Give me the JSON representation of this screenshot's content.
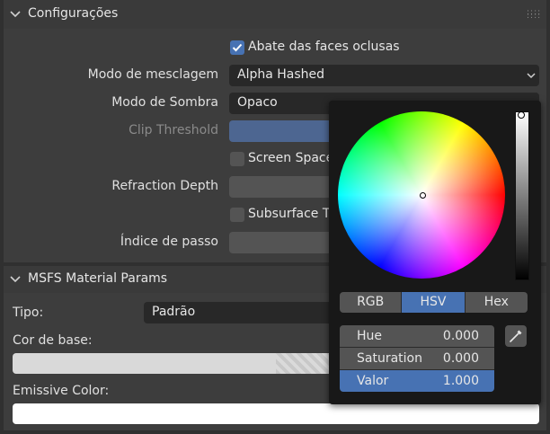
{
  "config_panel": {
    "title": "Configurações",
    "backface_label": "Abate das faces oclusas",
    "blend_mode_label": "Modo de mesclagem",
    "blend_mode_value": "Alpha Hashed",
    "shadow_mode_label": "Modo de Sombra",
    "shadow_mode_value": "Opaco",
    "clip_threshold_label": "Clip Threshold",
    "screen_space_label": "Screen Space",
    "refraction_depth_label": "Refraction Depth",
    "subsurface_label": "Subsurface T",
    "pass_index_label": "Índice de passo"
  },
  "msfs_panel": {
    "title": "MSFS Material Params",
    "type_label": "Tipo:",
    "type_value": "Padrão",
    "base_color_label": "Cor de base:",
    "emissive_label": "Emissive Color:"
  },
  "color_picker": {
    "tabs": [
      "RGB",
      "HSV",
      "Hex"
    ],
    "active_tab": "HSV",
    "sliders": [
      {
        "label": "Hue",
        "value": "0.000"
      },
      {
        "label": "Saturation",
        "value": "0.000"
      },
      {
        "label": "Valor",
        "value": "1.000"
      }
    ],
    "value_fraction": 1.0,
    "eyedropper_icon": "eyedropper-icon"
  },
  "colors": {
    "accent": "#4772b3",
    "panel": "#3d3d3d",
    "popup": "#181818",
    "field": "#545454"
  }
}
